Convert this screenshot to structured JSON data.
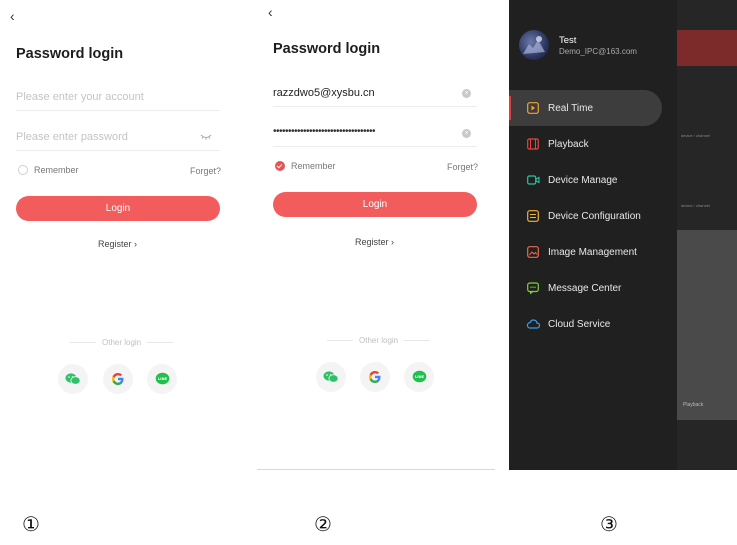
{
  "screen1": {
    "back_glyph": "‹",
    "title": "Password login",
    "account_placeholder": "Please enter your account",
    "password_placeholder": "Please enter password",
    "remember_label": "Remember",
    "forget_label": "Forget?",
    "login_label": "Login",
    "register_label": "Register ›",
    "other_login_label": "Other login",
    "social": [
      "wechat-icon",
      "google-icon",
      "line-icon"
    ]
  },
  "screen2": {
    "back_glyph": "‹",
    "title": "Password login",
    "account_value": "razzdwo5@xysbu.cn",
    "password_value": "••••••••••••••••••••••••••••••••••",
    "remember_label": "Remember",
    "remember_checked": true,
    "forget_label": "Forget?",
    "login_label": "Login",
    "register_label": "Register ›",
    "other_login_label": "Other login"
  },
  "screen3": {
    "user_name": "Test",
    "user_email": "Demo_IPC@163.com",
    "menu": [
      {
        "label": "Real Time",
        "icon": "realtime-icon",
        "active": true
      },
      {
        "label": "Playback",
        "icon": "playback-icon"
      },
      {
        "label": "Device Manage",
        "icon": "device-manage-icon"
      },
      {
        "label": "Device Configuration",
        "icon": "device-config-icon"
      },
      {
        "label": "Image Management",
        "icon": "image-icon"
      },
      {
        "label": "Message Center",
        "icon": "message-icon"
      },
      {
        "label": "Cloud Service",
        "icon": "cloud-icon"
      }
    ],
    "background_tab_label": "Playback",
    "background_channel_label": "device / channel"
  },
  "labels": [
    "①",
    "②",
    "③"
  ],
  "colors": {
    "accent": "#f35c5c",
    "drawer_bg": "#202020",
    "active_marker": "#e23c3c"
  }
}
